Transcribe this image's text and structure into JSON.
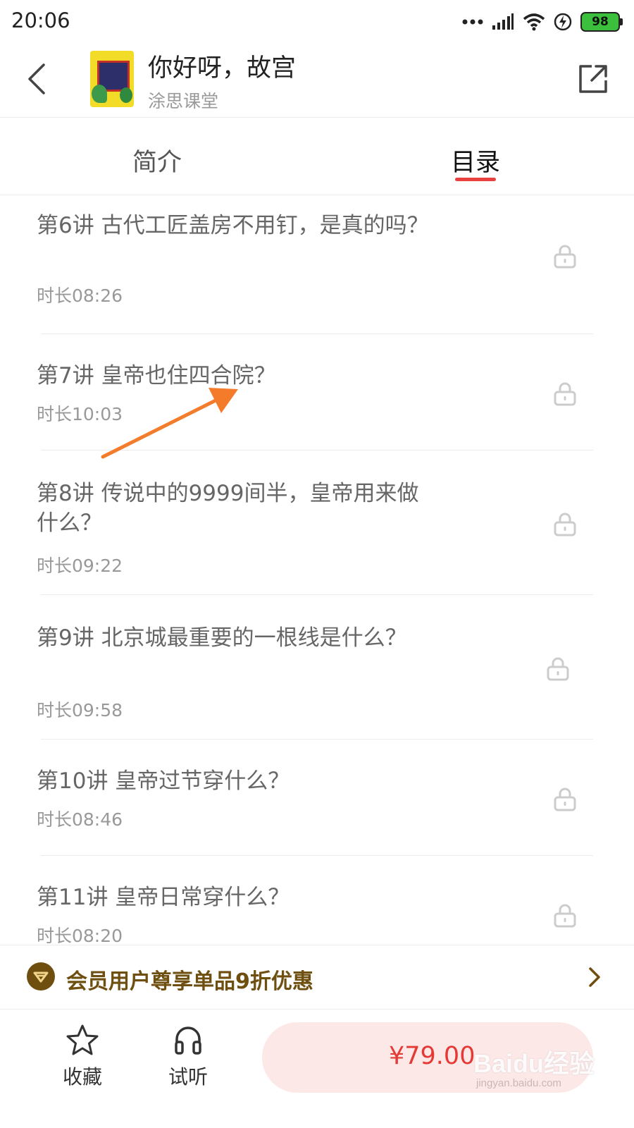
{
  "status_bar": {
    "time": "20:06",
    "battery": "98"
  },
  "header": {
    "title": "你好呀，故宫",
    "subtitle": "涂思课堂",
    "back_icon": "chevron-left-icon",
    "share_icon": "share-icon"
  },
  "tabs": [
    {
      "label": "简介",
      "active": false
    },
    {
      "label": "目录",
      "active": true
    }
  ],
  "accent_color": "#e8413f",
  "lessons": [
    {
      "title": "第6讲 古代工匠盖房不用钉，是真的吗？",
      "duration": "时长08:26",
      "locked": true
    },
    {
      "title": "第7讲 皇帝也住四合院？",
      "duration": "时长10:03",
      "locked": true
    },
    {
      "title": "第8讲 传说中的9999间半，皇帝用来做什么？",
      "duration": "时长09:22",
      "locked": true
    },
    {
      "title": "第9讲 北京城最重要的一根线是什么？",
      "duration": "时长09:58",
      "locked": true
    },
    {
      "title": "第10讲 皇帝过节穿什么？",
      "duration": "时长08:46",
      "locked": true
    },
    {
      "title": "第11讲 皇帝日常穿什么？",
      "duration": "时长08:20",
      "locked": true
    }
  ],
  "member_banner": {
    "text": "会员用户尊享单品9折优惠",
    "color": "#6e4f10"
  },
  "bottom_bar": {
    "favorite_label": "收藏",
    "listen_label": "试听",
    "price": "¥79.00",
    "price_color": "#e53935"
  },
  "watermark": {
    "brand": "Baidu经验",
    "url": "jingyan.baidu.com"
  }
}
